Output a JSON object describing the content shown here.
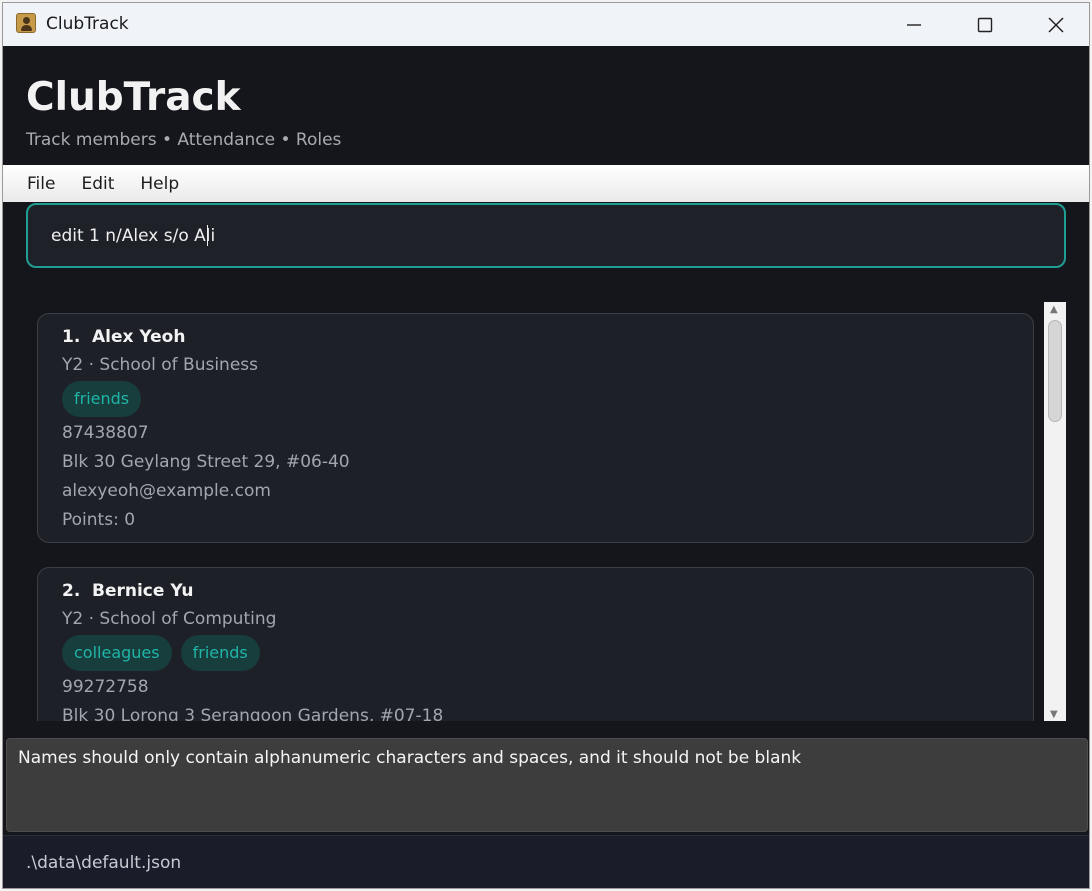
{
  "window": {
    "title": "ClubTrack",
    "minimize_glyph": "—",
    "maximize_glyph": "☐",
    "close_glyph": "✕"
  },
  "header": {
    "brand": "ClubTrack",
    "subtitle": "Track members • Attendance • Roles"
  },
  "menu": {
    "file": "File",
    "edit": "Edit",
    "help": "Help"
  },
  "command": {
    "value": "edit 1 n/Alex s/o Ali"
  },
  "persons": [
    {
      "index": "1.",
      "name": "Alex Yeoh",
      "year_faculty": "Y2 · School of Business",
      "tags": [
        "friends"
      ],
      "phone": "87438807",
      "address": "Blk 30 Geylang Street 29, #06-40",
      "email": "alexyeoh@example.com",
      "points": "Points: 0"
    },
    {
      "index": "2.",
      "name": "Bernice Yu",
      "year_faculty": "Y2 · School of Computing",
      "tags": [
        "colleagues",
        "friends"
      ],
      "phone": "99272758",
      "address": "Blk 30 Lorong 3 Serangoon Gardens, #07-18"
    }
  ],
  "result": {
    "message": "Names should only contain alphanumeric characters and spaces, and it should not be blank"
  },
  "status": {
    "file_path": ".\\data\\default.json"
  },
  "colors": {
    "accent": "#1f9e94",
    "tag_bg": "#173d3c",
    "tag_text": "#1fb5a7",
    "background": "#15161b"
  }
}
